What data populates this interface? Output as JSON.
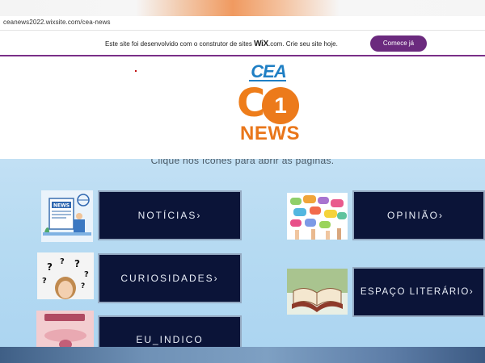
{
  "browser": {
    "url": "ceanews2022.wixsite.com/cea-news"
  },
  "wix_banner": {
    "message_prefix": "Este site foi desenvolvido com o construtor de sites ",
    "brand": "WiX",
    "message_suffix": ".com. Crie seu site hoje.",
    "cta_label": "Comece já",
    "accent_color": "#6b2a7e"
  },
  "logo": {
    "top_text": "CEA",
    "big_letter": "C",
    "number": "1",
    "bottom_text": "NEWS",
    "colors": {
      "cea": "#1f7fc4",
      "orange": "#ec7a1b"
    }
  },
  "instruction": "Clique nos ícones para abrir as páginas.",
  "sections": [
    {
      "label": "NOTÍCIAS›",
      "image": "news-illustration"
    },
    {
      "label": "CURIOSIDADES›",
      "image": "question-marks-woman"
    },
    {
      "label": "EU_INDICO",
      "image": "important-sticker"
    },
    {
      "label": "OPINIÃO›",
      "image": "speech-bubbles-hands"
    },
    {
      "label": "ESPAÇO LITERÁRIO›",
      "image": "open-book"
    }
  ],
  "colors": {
    "tile_bg": "#0b1438",
    "tile_text": "#e9eef8"
  }
}
